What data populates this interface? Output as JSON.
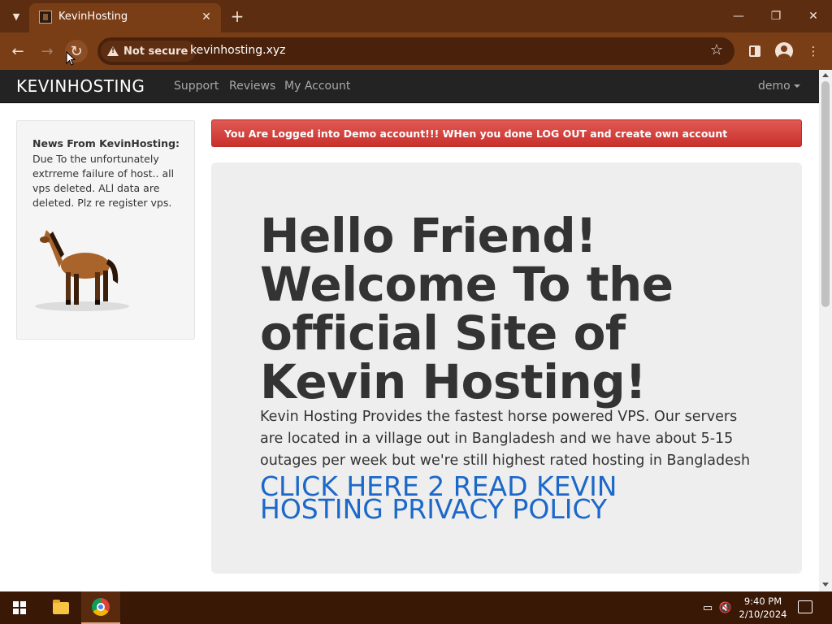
{
  "browser": {
    "tab_title": "KevinHosting",
    "security_label": "Not secure",
    "url": "kevinhosting.xyz",
    "icons": {
      "tab_list": "chevron-down-icon",
      "close_tab": "close-icon",
      "new_tab": "plus-icon",
      "back": "arrow-left-icon",
      "forward": "arrow-right-icon",
      "reload": "reload-icon",
      "bookmark": "star-icon",
      "side_panel": "side-panel-icon",
      "profile": "profile-icon",
      "menu": "kebab-menu-icon"
    }
  },
  "site": {
    "brand": "KEVINHOSTING",
    "nav": [
      "Support",
      "Reviews",
      "My Account"
    ],
    "user_menu": "demo",
    "news": {
      "title": "News From KevinHosting:",
      "body": "Due To the unfortunately extrreme failure of host.. all vps deleted. ALl data are deleted. Plz re register vps."
    },
    "alert": "You Are Logged into Demo account!!! WHen you done LOG OUT and create own account",
    "hero": {
      "heading": "Hello Friend! Welcome To the official Site of Kevin Hosting!",
      "text": "Kevin Hosting Provides the fastest horse powered VPS. Our servers are located in a village out in Bangladesh and we have about 5-15 outages per week but we're still highest rated hosting in Bangladesh",
      "link": "CLICK HERE 2 READ KEVIN HOSTING PRIVACY POLICY"
    },
    "colors": {
      "navbar": "#232323",
      "alert": "#d9534f",
      "link": "#1c68c9",
      "jumbotron": "#eeeeee"
    }
  },
  "taskbar": {
    "time": "9:40 PM",
    "date": "2/10/2024",
    "apps": [
      "file-explorer-icon",
      "chrome-icon"
    ]
  }
}
